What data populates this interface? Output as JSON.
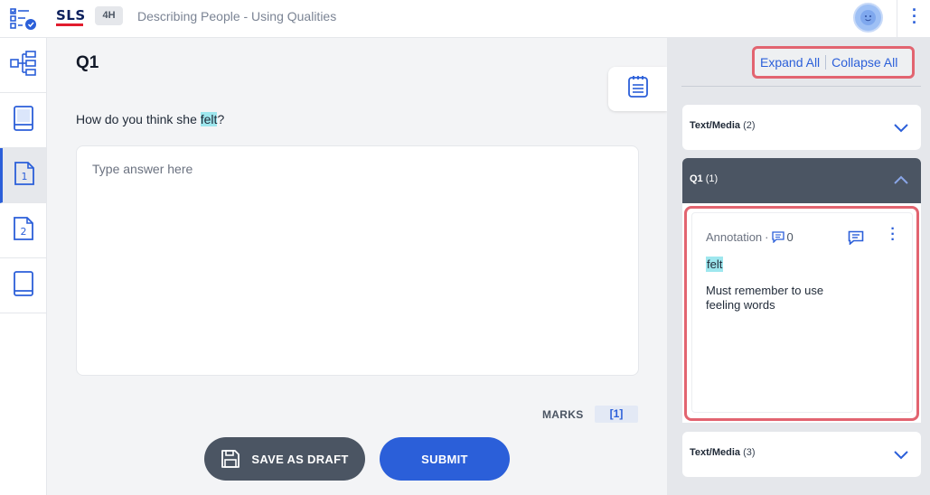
{
  "header": {
    "logo": "SLS",
    "level_badge": "4H",
    "title": "Describing People - Using Qualities"
  },
  "leftnav": {
    "items": [
      {
        "name": "flow",
        "icon": "flow-tree-icon"
      },
      {
        "name": "book",
        "icon": "book-icon"
      },
      {
        "name": "page-1",
        "icon": "page-1-icon",
        "label": "1"
      },
      {
        "name": "page-2",
        "icon": "page-2-icon",
        "label": "2"
      },
      {
        "name": "notebook",
        "icon": "notebook-icon"
      }
    ]
  },
  "main": {
    "question_title": "Q1",
    "question_before": "How do you think she ",
    "question_highlight": "felt",
    "question_after": "?",
    "answer_placeholder": "Type answer here",
    "marks_label": "MARKS",
    "marks_value": "[1]",
    "save_draft_label": "SAVE AS DRAFT",
    "submit_label": "SUBMIT"
  },
  "panel": {
    "expand_all": "Expand All",
    "collapse_all": "Collapse All",
    "sections": [
      {
        "title": "Text/Media",
        "count": "(2)",
        "state": "collapsed"
      },
      {
        "title": "Q1",
        "count": "(1)",
        "state": "expanded"
      },
      {
        "title": "Text/Media",
        "count": "(3)",
        "state": "collapsed"
      }
    ],
    "annotation": {
      "label": "Annotation",
      "separator": "·",
      "comment_count": "0",
      "quote": "felt",
      "text": "Must remember to use feeling words"
    }
  },
  "colors": {
    "accent": "#2b5fd9",
    "highlight": "#9ee7ee",
    "focus_outline": "#e26470",
    "open_section": "#4b5563"
  }
}
